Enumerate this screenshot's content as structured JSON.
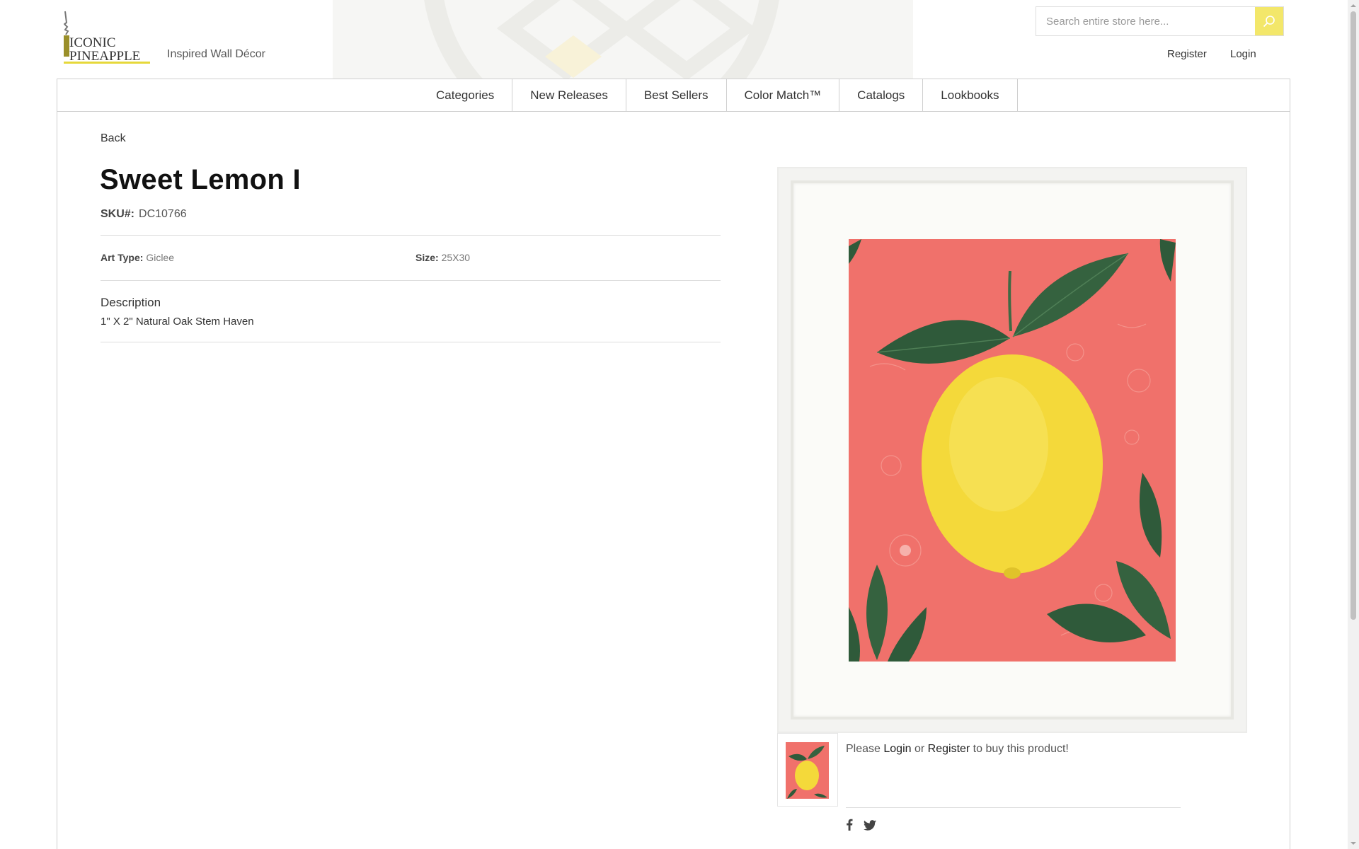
{
  "header": {
    "logo_line1": "ICONIC",
    "logo_line2": "PINEAPPLE",
    "tagline": "Inspired Wall Décor",
    "search_placeholder": "Search entire store here...",
    "register_label": "Register",
    "login_label": "Login"
  },
  "nav": {
    "items": [
      "Categories",
      "New Releases",
      "Best Sellers",
      "Color Match™",
      "Catalogs",
      "Lookbooks"
    ]
  },
  "product": {
    "back_label": "Back",
    "title": "Sweet Lemon I",
    "sku_label": "SKU#:",
    "sku_value": "DC10766",
    "art_type_label": "Art Type:",
    "art_type_value": "Giclee",
    "size_label": "Size:",
    "size_value": "25X30",
    "description_heading": "Description",
    "description_text": "1\" X 2\" Natural Oak Stem Haven"
  },
  "purchase": {
    "msg_before": "Please ",
    "login_link": "Login",
    "msg_middle": " or ",
    "register_link": "Register",
    "msg_after": " to buy this product!"
  },
  "social": [
    "facebook-icon",
    "twitter-icon"
  ],
  "colors": {
    "accent": "#f3e76a",
    "art_background": "#f0716b",
    "lemon": "#f4d93a",
    "leaf": "#2f5a3a"
  }
}
